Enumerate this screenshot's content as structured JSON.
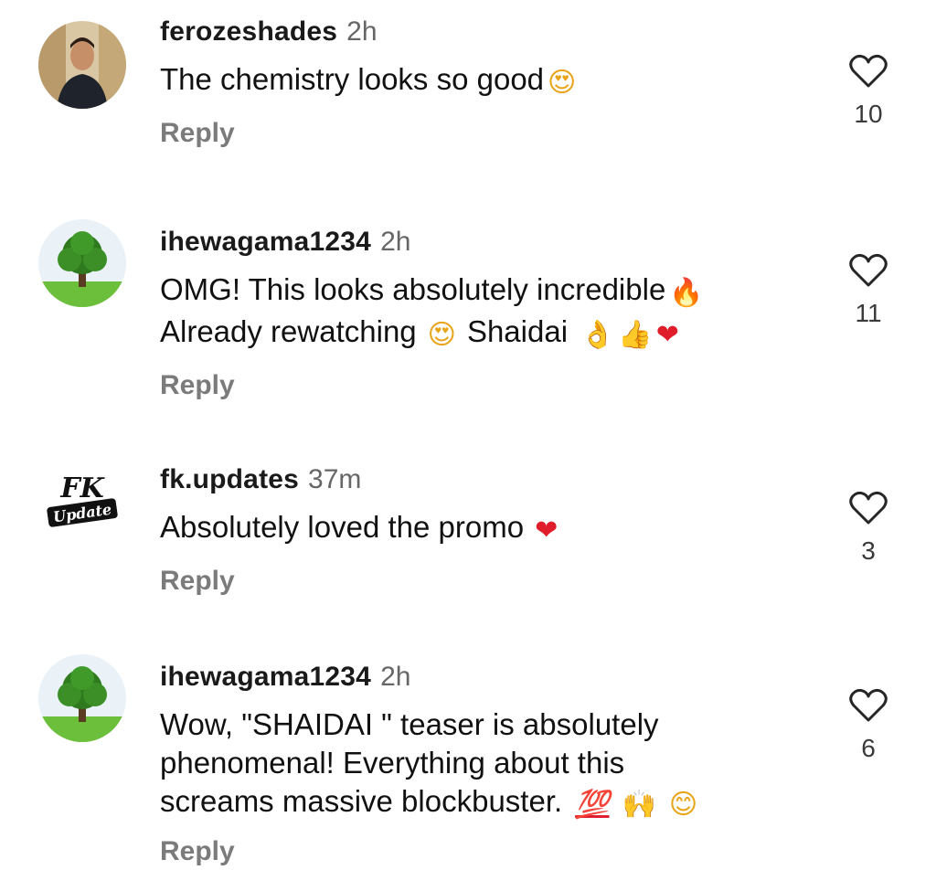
{
  "comments": [
    {
      "username": "ferozeshades",
      "time": "2h",
      "lines": [
        "The chemistry looks so good"
      ],
      "emoji_line0": "😍",
      "reply_label": "Reply",
      "likes": "10",
      "avatar": "profile-photo"
    },
    {
      "username": "ihewagama1234",
      "time": "2h",
      "lines": [
        "OMG! This looks absolutely incredible",
        "Already rewatching",
        "Shaidai"
      ],
      "emoji_fire": "🔥",
      "emoji_love": "😍",
      "emoji_ok": "👌",
      "emoji_thumb": "👍",
      "emoji_heart": "❤",
      "reply_label": "Reply",
      "likes": "11",
      "avatar": "tree-icon"
    },
    {
      "username": "fk.updates",
      "time": "37m",
      "lines": [
        "Absolutely loved the promo"
      ],
      "emoji_heart": "❤",
      "reply_label": "Reply",
      "likes": "3",
      "avatar": "fk-update-logo"
    },
    {
      "username": "ihewagama1234",
      "time": "2h",
      "lines": [
        "Wow, \"SHAIDAI \" teaser is absolutely",
        "phenomenal! Everything about this",
        "screams massive blockbuster."
      ],
      "emoji_hundred": "💯",
      "emoji_raise": "🙌",
      "emoji_smile": "😊",
      "reply_label": "Reply",
      "likes": "6",
      "avatar": "tree-icon"
    }
  ],
  "colors": {
    "text": "#111111",
    "muted": "#7b7b7b",
    "time": "#666666",
    "heart_outline": "#262626"
  }
}
